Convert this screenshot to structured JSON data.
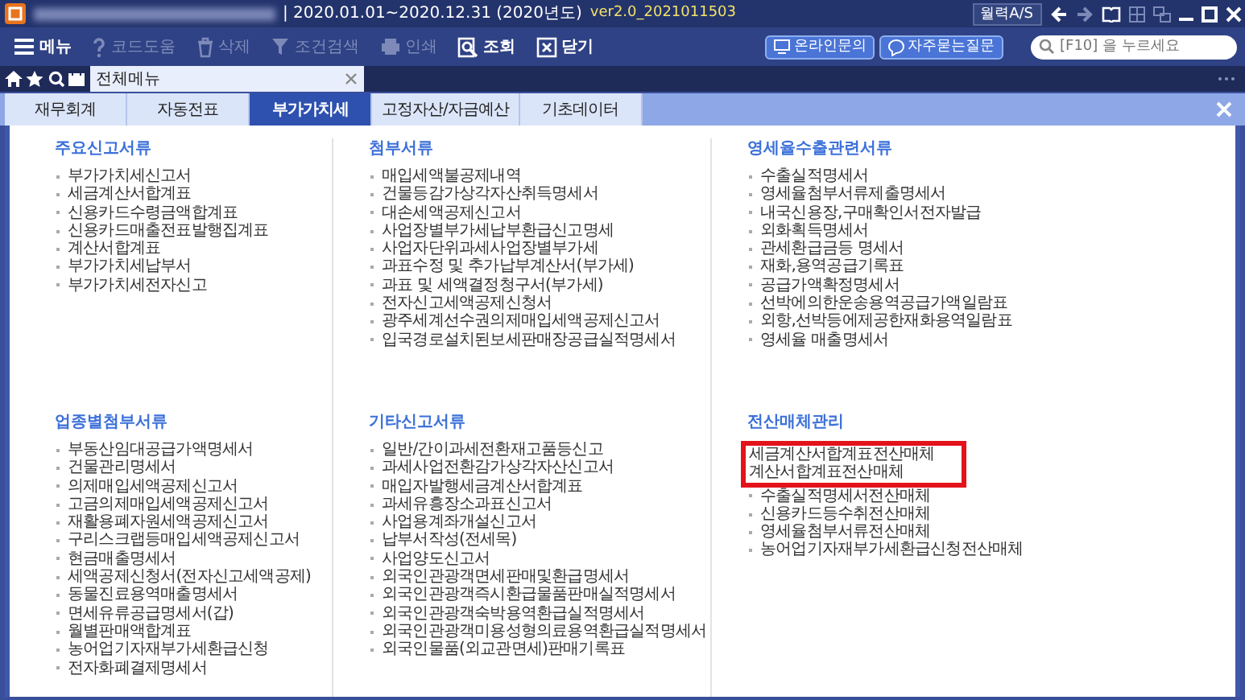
{
  "title_bar": {
    "period": "| 2020.01.01~2020.12.31  (2020년도)",
    "version": "ver2.0_2021011503",
    "support_button": "월력A/S"
  },
  "toolbar": {
    "buttons": [
      {
        "label": "메뉴",
        "disabled": false
      },
      {
        "label": "코드도움",
        "disabled": true
      },
      {
        "label": "삭제",
        "disabled": true
      },
      {
        "label": "조건검색",
        "disabled": true
      },
      {
        "label": "인쇄",
        "disabled": true
      },
      {
        "label": "조회",
        "disabled": false
      },
      {
        "label": "닫기",
        "disabled": false
      }
    ],
    "links": [
      "온라인문의",
      "자주묻는질문"
    ],
    "search": {
      "placeholder": "[F10] 을 누르세요"
    }
  },
  "open_tabs": [
    {
      "label": "전체메뉴",
      "selected": true
    }
  ],
  "category_tabs": [
    {
      "label": "재무회계",
      "selected": false
    },
    {
      "label": "자동전표",
      "selected": false
    },
    {
      "label": "부가가치세",
      "selected": true
    },
    {
      "label": "고정자산/자금예산",
      "selected": false
    },
    {
      "label": "기초데이터",
      "selected": false
    }
  ],
  "sections": [
    {
      "title": "주요신고서류",
      "items": [
        {
          "label": "부가가치세신고서"
        },
        {
          "label": "세금계산서합계표"
        },
        {
          "label": "신용카드수령금액합계표"
        },
        {
          "label": "신용카드매출전표발행집계표"
        },
        {
          "label": "계산서합계표"
        },
        {
          "label": "부가가치세납부서"
        },
        {
          "label": "부가가치세전자신고"
        }
      ]
    },
    {
      "title": "첨부서류",
      "items": [
        {
          "label": "매입세액불공제내역"
        },
        {
          "label": "건물등감가상각자산취득명세서"
        },
        {
          "label": "대손세액공제신고서"
        },
        {
          "label": "사업장별부가세납부환급신고명세"
        },
        {
          "label": "사업자단위과세사업장별부가세"
        },
        {
          "label": "과표수정 및 추가납부계산서(부가세)"
        },
        {
          "label": "과표 및 세액결정청구서(부가세)"
        },
        {
          "label": "전자신고세액공제신청서"
        },
        {
          "label": "광주세계선수권의제매입세액공제신고서"
        },
        {
          "label": "입국경로설치된보세판매장공급실적명세서"
        }
      ]
    },
    {
      "title": "영세율수출관련서류",
      "items": [
        {
          "label": "수출실적명세서"
        },
        {
          "label": "영세율첨부서류제출명세서"
        },
        {
          "label": "내국신용장,구매확인서전자발급"
        },
        {
          "label": "외화획득명세서"
        },
        {
          "label": "관세환급금등 명세서"
        },
        {
          "label": "재화,용역공급기록표"
        },
        {
          "label": "공급가액확정명세서"
        },
        {
          "label": "선박에의한운송용역공급가액일람표"
        },
        {
          "label": "외항,선박등에제공한재화용역일람표"
        },
        {
          "label": "영세율 매출명세서"
        }
      ]
    },
    {
      "title": "업종별첨부서류",
      "items": [
        {
          "label": "부동산임대공급가액명세서"
        },
        {
          "label": "건물관리명세서"
        },
        {
          "label": "의제매입세액공제신고서"
        },
        {
          "label": "고금의제매입세액공제신고서"
        },
        {
          "label": "재활용폐자원세액공제신고서"
        },
        {
          "label": "구리스크랩등매입세액공제신고서"
        },
        {
          "label": "현금매출명세서"
        },
        {
          "label": "세액공제신청서(전자신고세액공제)"
        },
        {
          "label": "동물진료용역매출명세서"
        },
        {
          "label": "면세유류공급명세서(갑)"
        },
        {
          "label": "월별판매액합계표"
        },
        {
          "label": "농어업기자재부가세환급신청"
        },
        {
          "label": "전자화폐결제명세서"
        }
      ]
    },
    {
      "title": "기타신고서류",
      "items": [
        {
          "label": "일반/간이과세전환재고품등신고"
        },
        {
          "label": "과세사업전환감가상각자산신고서"
        },
        {
          "label": "매입자발행세금계산서합계표"
        },
        {
          "label": "과세유흥장소과표신고서"
        },
        {
          "label": "사업용계좌개설신고서"
        },
        {
          "label": "납부서작성(전세목)"
        },
        {
          "label": "사업양도신고서"
        },
        {
          "label": "외국인관광객면세판매및환급명세서"
        },
        {
          "label": "외국인관광객즉시환급물품판매실적명세서"
        },
        {
          "label": "외국인관광객숙박용역환급실적명세서"
        },
        {
          "label": "외국인관광객미용성형의료용역환급실적명세서"
        },
        {
          "label": "외국인물품(외교관면세)판매기록표"
        }
      ]
    },
    {
      "title": "전산매체관리",
      "items": [
        {
          "label": "세금계산서합계표전산매체",
          "highlighted": true
        },
        {
          "label": "계산서합계표전산매체",
          "highlighted": true
        },
        {
          "label": "수출실적명세서전산매체",
          "highlighted": false
        },
        {
          "label": "신용카드등수취전산매체",
          "highlighted": false
        },
        {
          "label": "영세율첨부서류전산매체",
          "highlighted": false
        },
        {
          "label": "농어업기자재부가세환급신청전산매체",
          "highlighted": false
        }
      ]
    }
  ]
}
